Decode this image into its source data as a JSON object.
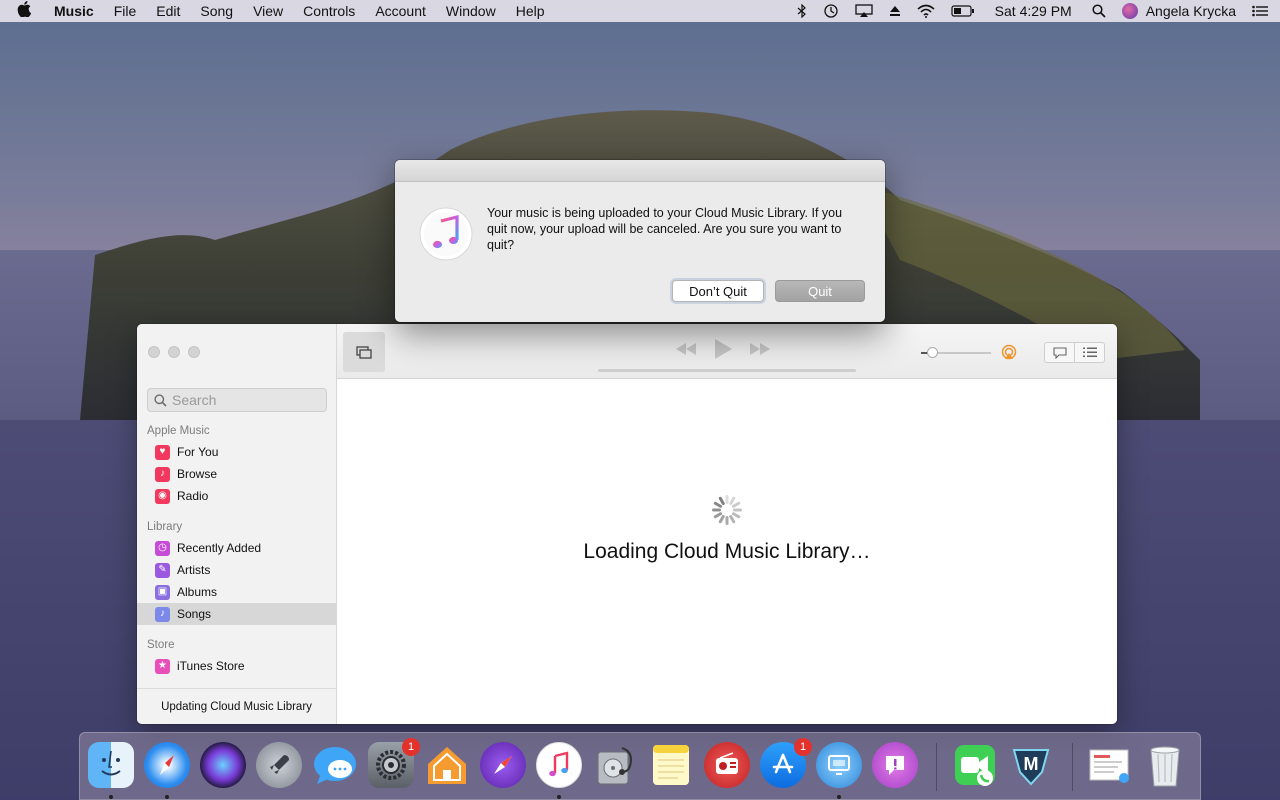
{
  "menubar": {
    "apple_icon": "apple-logo-icon",
    "app_name": "Music",
    "menus": [
      "File",
      "Edit",
      "Song",
      "View",
      "Controls",
      "Account",
      "Window",
      "Help"
    ],
    "clock": "Sat 4:29 PM",
    "user": "Angela Krycka",
    "status_icons": [
      "bluetooth-icon",
      "time-machine-icon",
      "airplay-icon",
      "eject-icon",
      "wifi-icon",
      "battery-icon",
      "spotlight-icon",
      "user-avatar-icon",
      "notification-center-icon"
    ]
  },
  "alert": {
    "message": "Your music is being uploaded to your Cloud Music Library. If you quit now, your upload will be canceled. Are you sure you want to quit?",
    "dont_quit_label": "Don’t Quit",
    "quit_label": "Quit",
    "icon": "music-app-icon"
  },
  "sidebar": {
    "search_placeholder": "Search",
    "sections": {
      "apple_music": "Apple Music",
      "library": "Library",
      "store": "Store"
    },
    "items": {
      "for_you": "For You",
      "browse": "Browse",
      "radio": "Radio",
      "recently_added": "Recently Added",
      "artists": "Artists",
      "albums": "Albums",
      "songs": "Songs",
      "itunes_store": "iTunes Store"
    },
    "selected": "Songs",
    "status": "Updating Cloud Music Library"
  },
  "main": {
    "loading_text": "Loading Cloud Music Library…"
  },
  "player": {
    "volume_fraction": 0.15
  },
  "dock": {
    "apps": [
      "Finder",
      "Safari",
      "Siri",
      "Launchpad",
      "Messages",
      "System Preferences",
      "Home",
      "Compass",
      "Music",
      "Disk Utility",
      "Notes",
      "Radio",
      "App Store",
      "Screen Sharing",
      "Feedback Assistant",
      "FaceTime",
      "Metaglass",
      "Document",
      "Trash"
    ],
    "system_preferences_badge": "1",
    "app_store_badge": "1"
  },
  "colors": {
    "accent_pink": "#fa3b6e",
    "badge_red": "#e3322b",
    "airplay_orange": "#f0932b"
  }
}
